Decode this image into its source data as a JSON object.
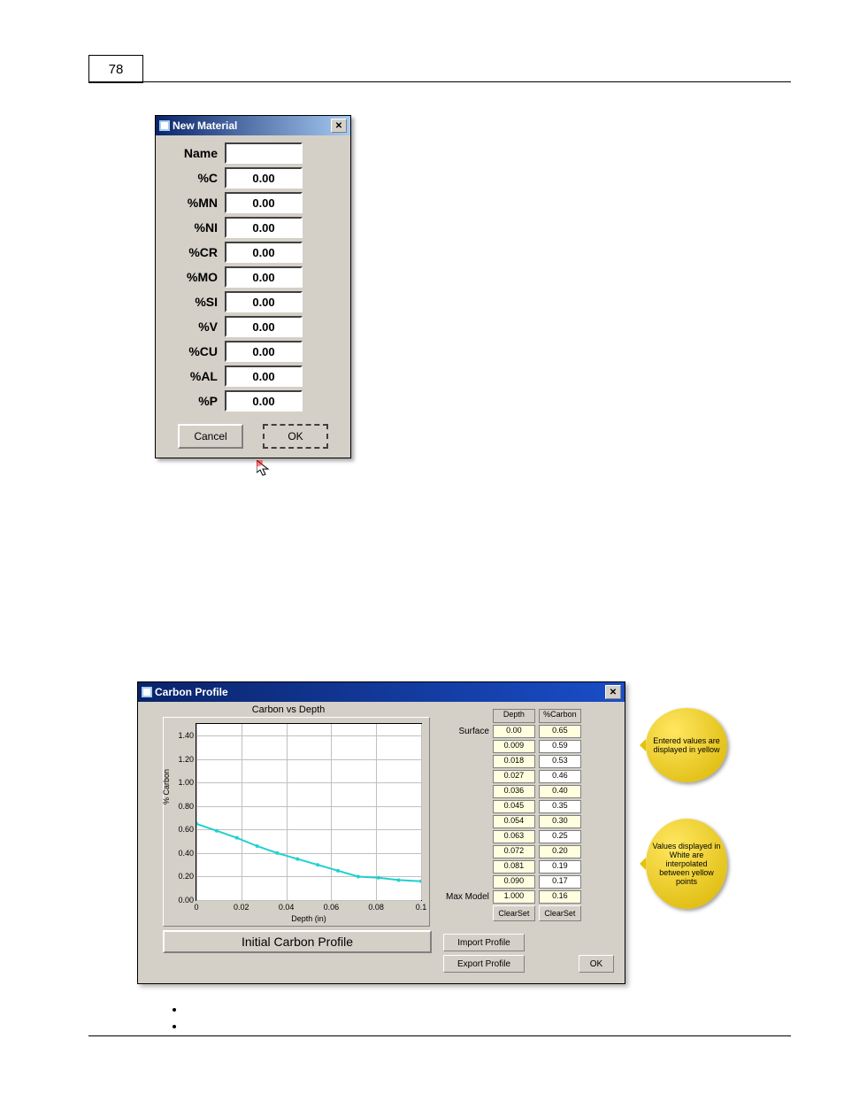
{
  "page_number": "78",
  "window_new_material": {
    "title": "New Material",
    "fields": [
      {
        "label": "Name",
        "value": ""
      },
      {
        "label": "%C",
        "value": "0.00"
      },
      {
        "label": "%MN",
        "value": "0.00"
      },
      {
        "label": "%NI",
        "value": "0.00"
      },
      {
        "label": "%CR",
        "value": "0.00"
      },
      {
        "label": "%MO",
        "value": "0.00"
      },
      {
        "label": "%SI",
        "value": "0.00"
      },
      {
        "label": "%V",
        "value": "0.00"
      },
      {
        "label": "%CU",
        "value": "0.00"
      },
      {
        "label": "%AL",
        "value": "0.00"
      },
      {
        "label": "%P",
        "value": "0.00"
      }
    ],
    "cancel": "Cancel",
    "ok": "OK"
  },
  "window_carbon_profile": {
    "title": "Carbon Profile",
    "chart_title": "Carbon vs Depth",
    "bottom_bar": "Initial Carbon Profile",
    "xlabel": "Depth (in)",
    "ylabel": "% Carbon",
    "surface_label": "Surface",
    "maxmodel_label": "Max Model",
    "headers": {
      "depth": "Depth",
      "carbon": "%Carbon"
    },
    "rows": [
      {
        "depth": "0.00",
        "carbon": "0.65",
        "carbon_entered": true
      },
      {
        "depth": "0.009",
        "carbon": "0.59"
      },
      {
        "depth": "0.018",
        "carbon": "0.53"
      },
      {
        "depth": "0.027",
        "carbon": "0.46"
      },
      {
        "depth": "0.036",
        "carbon": "0.40",
        "carbon_entered": true
      },
      {
        "depth": "0.045",
        "carbon": "0.35"
      },
      {
        "depth": "0.054",
        "carbon": "0.30",
        "carbon_entered": true
      },
      {
        "depth": "0.063",
        "carbon": "0.25"
      },
      {
        "depth": "0.072",
        "carbon": "0.20",
        "carbon_entered": true
      },
      {
        "depth": "0.081",
        "carbon": "0.19"
      },
      {
        "depth": "0.090",
        "carbon": "0.17"
      },
      {
        "depth": "1.000",
        "carbon": "0.16",
        "carbon_entered": true
      }
    ],
    "clear_set": "ClearSet",
    "import": "Import Profile",
    "export": "Export Profile",
    "ok": "OK",
    "callout1": "Entered values are displayed in yellow",
    "callout2": "Values displayed in White are interpolated between yellow points"
  },
  "chart_data": {
    "type": "line",
    "title": "Carbon vs Depth",
    "xlabel": "Depth (in)",
    "ylabel": "% Carbon",
    "xlim": [
      0,
      0.1
    ],
    "ylim": [
      0,
      1.5
    ],
    "xticks": [
      0,
      0.02,
      0.04,
      0.06,
      0.08,
      0.1
    ],
    "yticks": [
      0.0,
      0.2,
      0.4,
      0.6,
      0.8,
      1.0,
      1.2,
      1.4
    ],
    "series": [
      {
        "name": "Carbon",
        "x": [
          0.0,
          0.009,
          0.018,
          0.027,
          0.036,
          0.045,
          0.054,
          0.063,
          0.072,
          0.081,
          0.09,
          0.1
        ],
        "values": [
          0.65,
          0.59,
          0.53,
          0.46,
          0.4,
          0.35,
          0.3,
          0.25,
          0.2,
          0.19,
          0.17,
          0.16
        ]
      }
    ]
  }
}
